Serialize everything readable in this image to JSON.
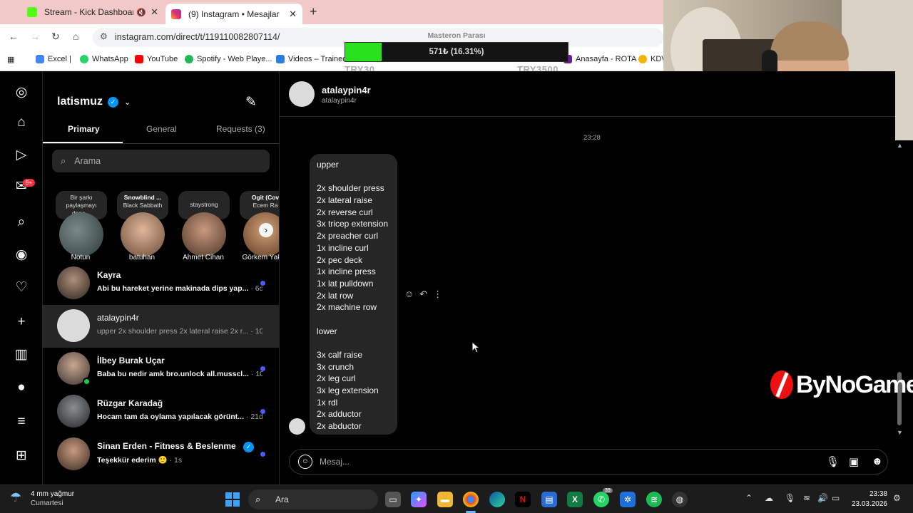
{
  "browser": {
    "tabs": [
      {
        "title": "Stream - Kick Dashboard",
        "favicon_color": "#53fc18"
      },
      {
        "title": "(9) Instagram • Mesajlar",
        "favicon_color": "#e1306c"
      }
    ],
    "url": "instagram.com/direct/t/119110082807114/",
    "bookmarks": [
      "Excel |",
      "WhatsApp",
      "YouTube",
      "Spotify - Web Playe...",
      "Videos – Trained b",
      "Anasayfa - ROTA",
      "KDV"
    ]
  },
  "overlay": {
    "title": "Masteron Parası",
    "progress_text": "571₺ (16.31%)",
    "progress_percent": 16.31,
    "min_label": "TRY30",
    "max_label": "TRY3500"
  },
  "instagram": {
    "account": "latismuz",
    "notification_badge": "9+",
    "inbox_tabs": [
      "Primary",
      "General",
      "Requests (3)"
    ],
    "search_placeholder": "Arama",
    "notes": [
      {
        "bubble": "Bir şarkı paylaşmayı dene...",
        "name": "Notun"
      },
      {
        "bubble_title": "Snowblind ...",
        "bubble_sub": "Black Sabbath",
        "name": "batuhan"
      },
      {
        "bubble": "staystrong",
        "name": "Ahmet Cihan"
      },
      {
        "bubble_title": "Ogit (Cov",
        "bubble_sub": "Ecem Ra",
        "name": "Görkem Yakut"
      }
    ],
    "threads": [
      {
        "name": "Kayra",
        "preview": "Abi bu hareket yerine makinada dips yap...",
        "time": "· 6d",
        "unread": true
      },
      {
        "name": "atalaypin4r",
        "preview": "upper 2x shoulder press 2x lateral raise 2x r...",
        "time": "· 10d",
        "unread": false
      },
      {
        "name": "İlbey Burak Uçar",
        "preview": "Baba bu nedir amk bro.unlock all.musscl...",
        "time": "· 10d",
        "unread": true
      },
      {
        "name": "Rüzgar Karadağ",
        "preview": "Hocam tam da oylama yapılacak görünt...",
        "time": "· 21d",
        "unread": true
      },
      {
        "name": "Sinan Erden - Fitness & Beslenme",
        "preview": "Teşekkür ederim 🙂",
        "time": "· 1s",
        "unread": true
      }
    ],
    "chat": {
      "name": "atalaypin4r",
      "handle": "atalaypin4r",
      "timestamp": "23:28",
      "message_lines": [
        "upper",
        "",
        "2x shoulder press",
        "2x lateral raise",
        "2x reverse curl",
        "3x tricep extension",
        "2x preacher curl",
        "1x incline curl",
        "2x pec deck",
        "1x incline press",
        "1x lat pulldown",
        "2x lat row",
        "2x machine row",
        "",
        "lower",
        "",
        "3x calf raise",
        "3x crunch",
        "2x leg curl",
        "3x leg extension",
        "1x rdl",
        "2x adductor",
        "2x abductor"
      ],
      "composer_placeholder": "Mesaj..."
    }
  },
  "watermark": "ByNoGame",
  "taskbar": {
    "weather_temp": "4 mm yağmur",
    "weather_day": "Cumartesi",
    "search": "Ara",
    "whatsapp_badge": "39",
    "time": "23:38",
    "date": "23.03.2026"
  }
}
